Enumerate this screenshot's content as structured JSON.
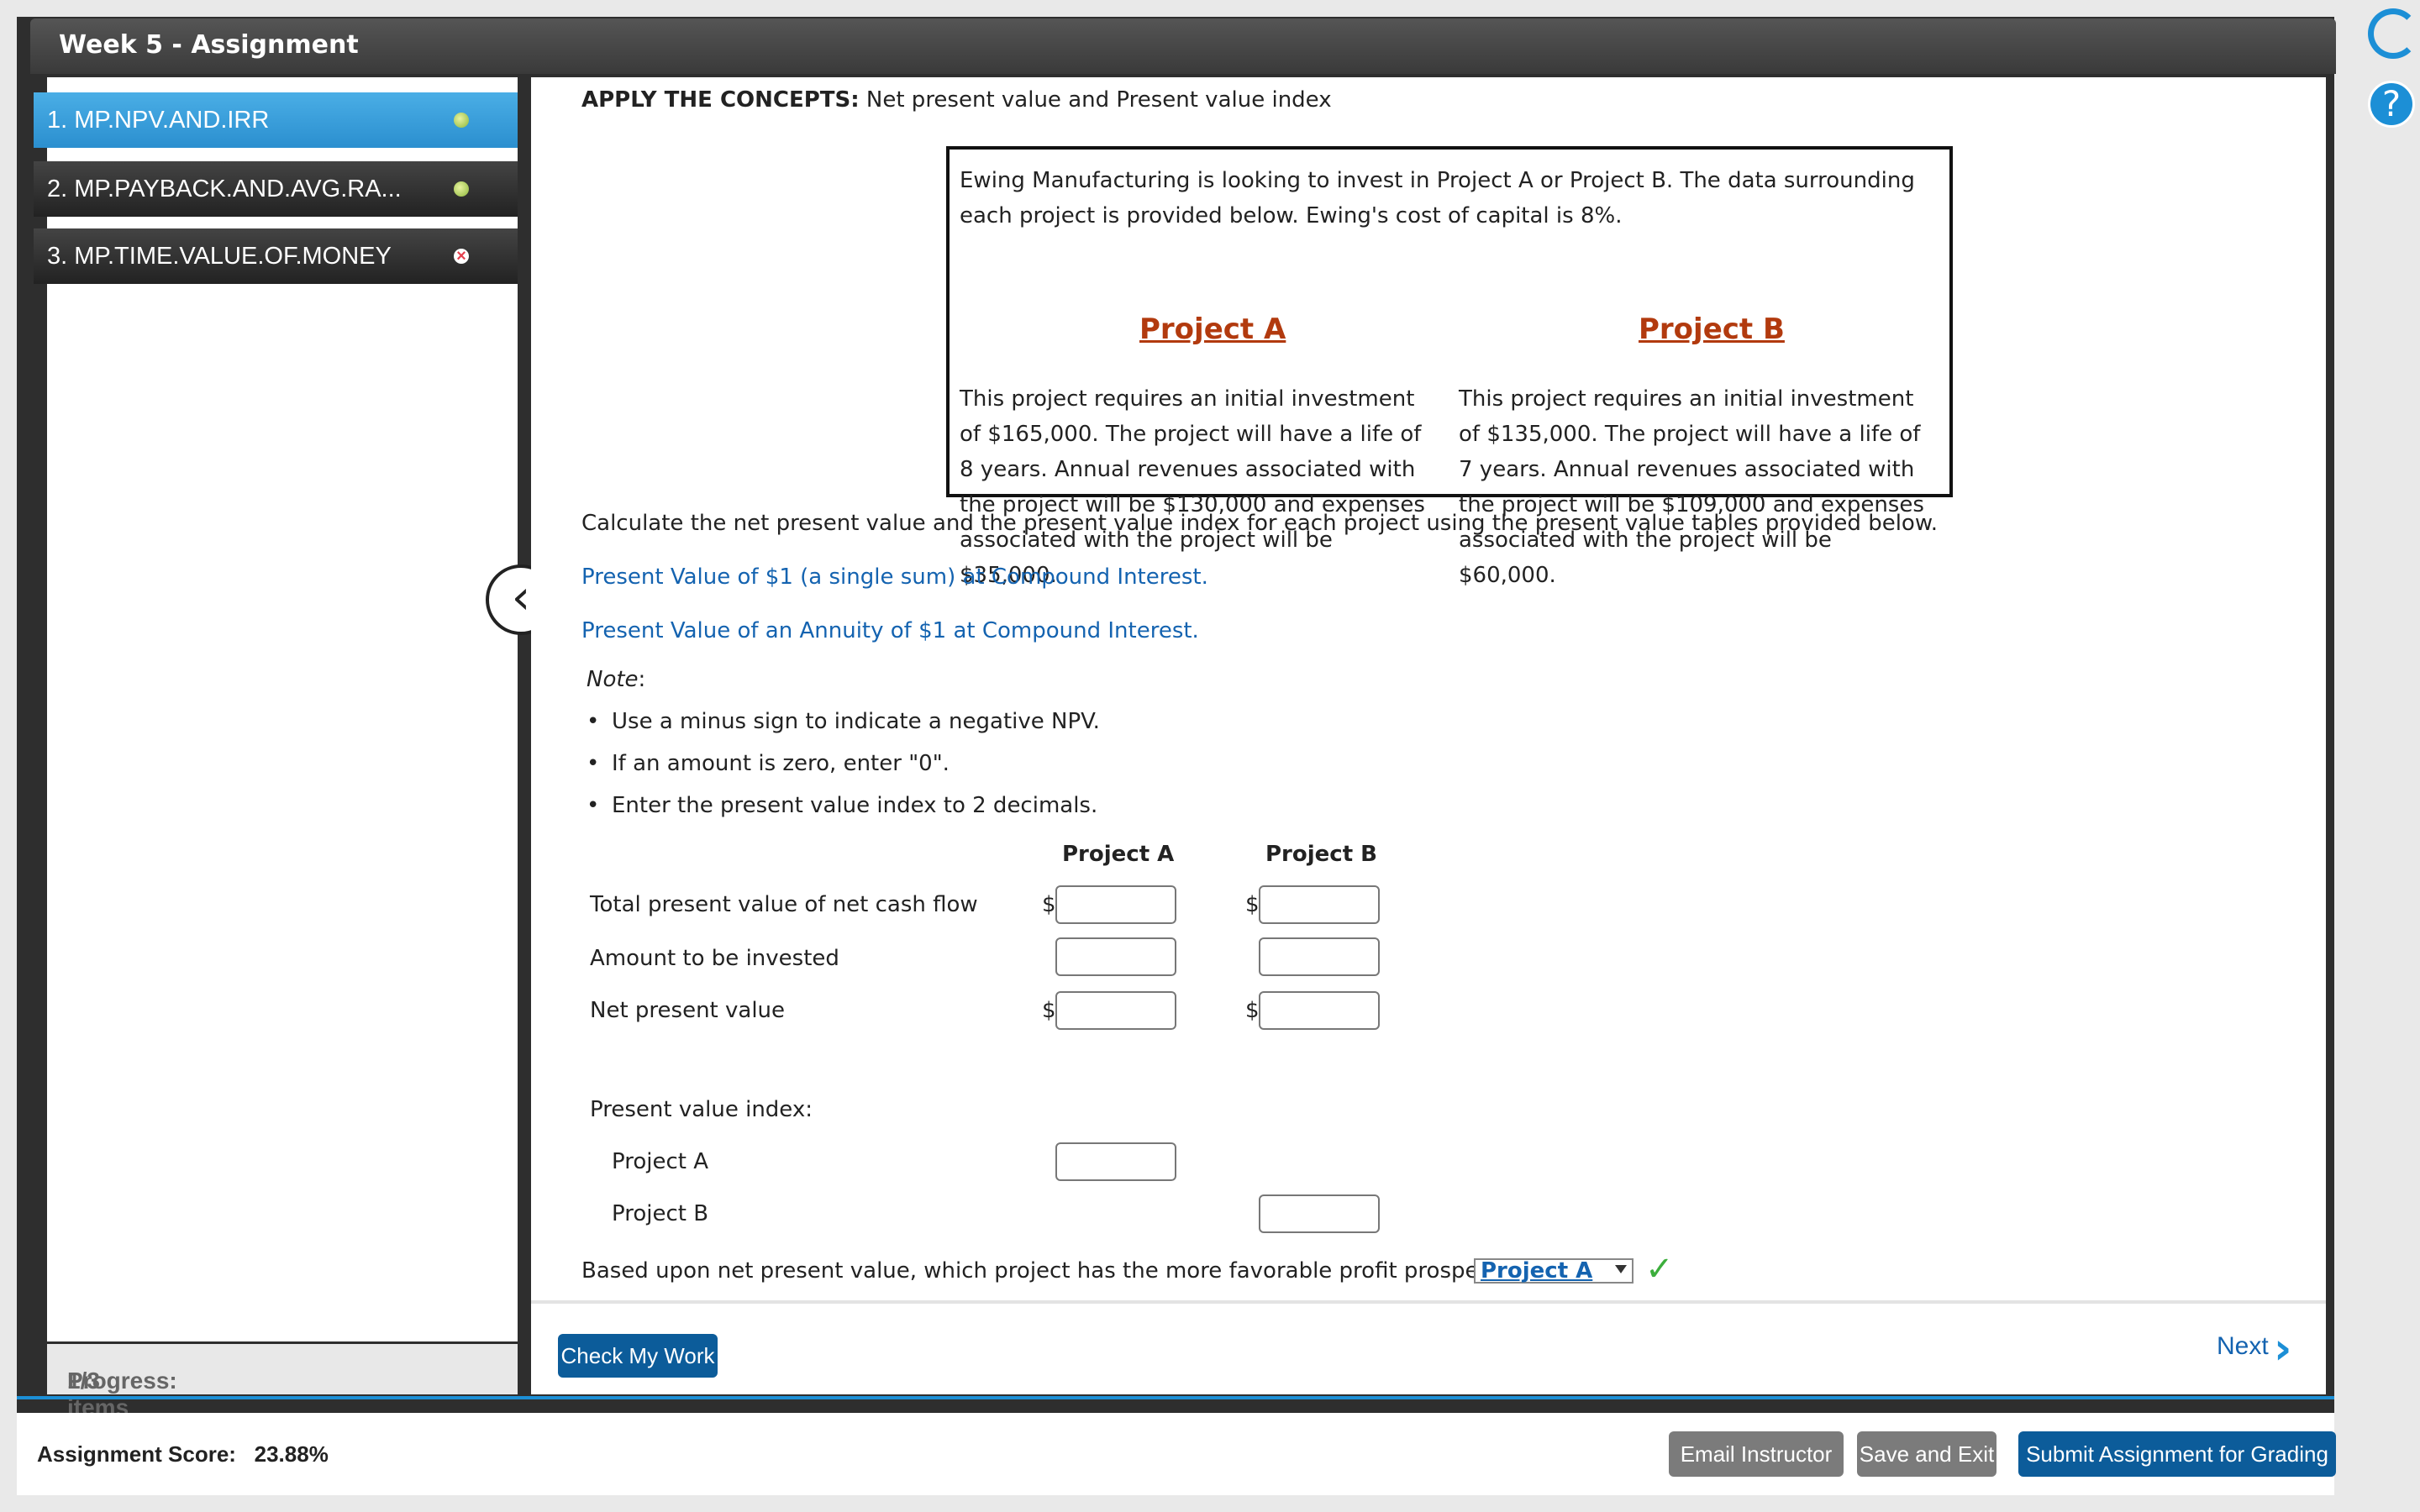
{
  "window": {
    "title": "Week 5 - Assignment"
  },
  "sidebar": {
    "items": [
      {
        "label": "1. MP.NPV.AND.IRR",
        "status": "answered"
      },
      {
        "label": "2. MP.PAYBACK.AND.AVG.RA...",
        "status": "answered"
      },
      {
        "label": "3. MP.TIME.VALUE.OF.MONEY",
        "status": "incorrect"
      }
    ],
    "progress_label": "Progress:",
    "progress_value": "1/3 items"
  },
  "question": {
    "heading_bold": "APPLY THE CONCEPTS:",
    "heading_text": "Net present value and Present value index",
    "intro": "Ewing Manufacturing is looking to invest in Project A or Project B. The data surrounding each project is provided below. Ewing's cost of capital is 8%.",
    "project_a": {
      "title": "Project A",
      "desc": "This project requires an initial investment of $165,000. The project will have a life of 8 years. Annual revenues associated with the project will be $130,000 and expenses associated with the project will be $35,000."
    },
    "project_b": {
      "title": "Project B",
      "desc": "This project requires an initial investment of $135,000. The project will have a life of 7 years. Annual revenues associated with the project will be $109,000 and expenses associated with the project will be $60,000."
    },
    "instruction": "Calculate the net present value and the present value index for each project using the present value tables provided below.",
    "link_pv_single": "Present Value of $1 (a single sum) at Compound Interest.",
    "link_pv_annuity": "Present Value of an Annuity of $1 at Compound Interest.",
    "note_label": "Note",
    "notes": [
      "Use a minus sign to indicate a negative NPV.",
      "If an amount is zero, enter \"0\".",
      "Enter the present value index to 2 decimals."
    ],
    "table": {
      "col_a": "Project A",
      "col_b": "Project B",
      "rows": [
        "Total present value of net cash flow",
        "Amount to be invested",
        "Net present value"
      ],
      "currency": "$",
      "pvi_label": "Present value index:",
      "pvi_a": "Project A",
      "pvi_b": "Project B"
    },
    "final_question": "Based upon net present value, which project has the more favorable profit prospects?",
    "final_answer": "Project A"
  },
  "actions": {
    "check_my_work": "Check My Work",
    "next": "Next",
    "email_instructor": "Email Instructor",
    "save_and_exit": "Save and Exit",
    "submit": "Submit Assignment for Grading"
  },
  "score": {
    "label": "Assignment Score:",
    "value": "23.88%"
  },
  "colors": {
    "accent": "#1c8fd6",
    "primary_button": "#0c5c9a",
    "project_title": "#b23a0e",
    "link": "#1463b0"
  }
}
